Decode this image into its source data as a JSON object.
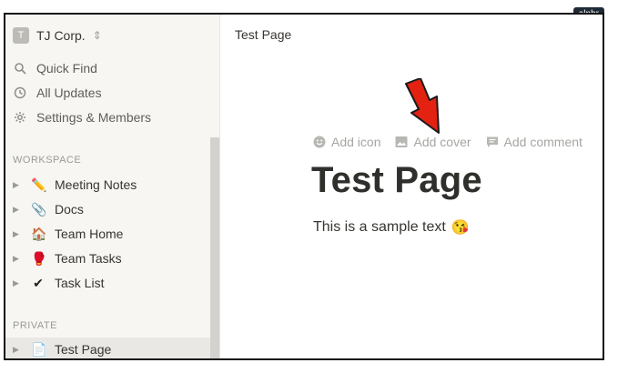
{
  "watermark": "alphr",
  "workspace": {
    "avatar_letter": "T",
    "name": "TJ Corp."
  },
  "nav": {
    "items": [
      {
        "label": "Quick Find",
        "icon": "search-icon"
      },
      {
        "label": "All Updates",
        "icon": "clock-icon"
      },
      {
        "label": "Settings & Members",
        "icon": "gear-icon"
      }
    ]
  },
  "sections": {
    "workspace_label": "WORKSPACE",
    "private_label": "PRIVATE"
  },
  "pages": {
    "workspace": [
      {
        "label": "Meeting Notes",
        "emoji": "✏️"
      },
      {
        "label": "Docs",
        "emoji": "📎"
      },
      {
        "label": "Team Home",
        "emoji": "🏠"
      },
      {
        "label": "Team Tasks",
        "emoji": "🥊"
      },
      {
        "label": "Task List",
        "emoji": "✔"
      }
    ],
    "private": [
      {
        "label": "Test Page",
        "emoji": "📄"
      }
    ]
  },
  "topbar": {
    "breadcrumb": "Test Page"
  },
  "actions": {
    "add_icon": "Add icon",
    "add_cover": "Add cover",
    "add_comment": "Add comment"
  },
  "main": {
    "title": "Test Page",
    "text": "This is a sample text",
    "text_emoji": "😘"
  },
  "colors": {
    "sidebar_bg": "#f7f6f3",
    "annotation_arrow": "#e32212",
    "muted_text": "#a6a5a1"
  }
}
